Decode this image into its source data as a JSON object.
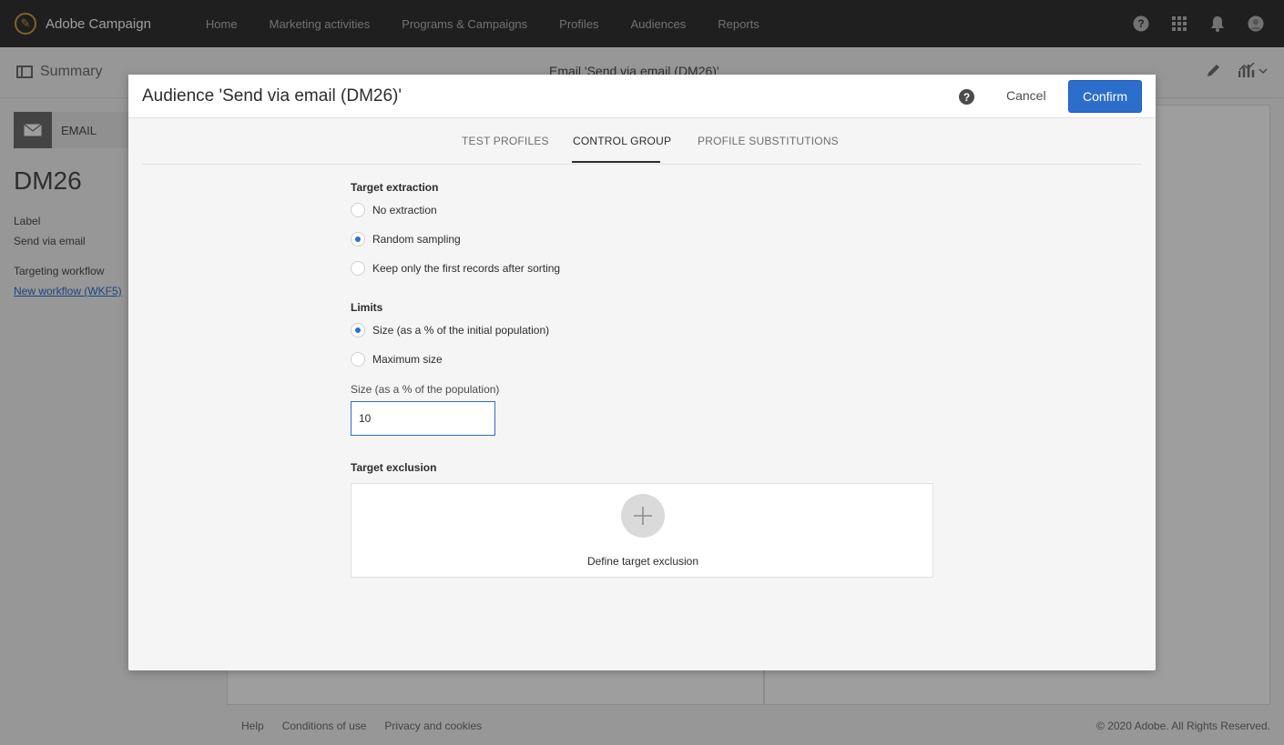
{
  "app": {
    "name": "Adobe Campaign"
  },
  "nav": [
    "Home",
    "Marketing activities",
    "Programs & Campaigns",
    "Profiles",
    "Audiences",
    "Reports"
  ],
  "top_icons": [
    "help-icon",
    "apps-grid-icon",
    "bell-icon",
    "avatar-icon"
  ],
  "subheader": {
    "summary": "Summary",
    "title": "Email 'Send via email (DM26)'"
  },
  "left": {
    "chip": "EMAIL",
    "code": "DM26",
    "label_caption": "Label",
    "label_value": "Send via email",
    "workflow_caption": "Targeting workflow",
    "workflow_link": "New workflow (WKF5)"
  },
  "footer": {
    "help": "Help",
    "terms": "Conditions of use",
    "privacy": "Privacy and cookies",
    "copyright": "© 2020 Adobe. All Rights Reserved."
  },
  "modal": {
    "title": "Audience 'Send via email (DM26)'",
    "cancel": "Cancel",
    "confirm": "Confirm",
    "tabs": [
      "TEST PROFILES",
      "CONTROL GROUP",
      "PROFILE SUBSTITUTIONS"
    ],
    "active_tab": "CONTROL GROUP",
    "target_extraction": {
      "label": "Target extraction",
      "options": [
        "No extraction",
        "Random sampling",
        "Keep only the first records after sorting"
      ],
      "selected": "Random sampling"
    },
    "limits": {
      "label": "Limits",
      "options": [
        "Size (as a % of the initial population)",
        "Maximum size"
      ],
      "selected": "Size (as a % of the initial population)"
    },
    "size_field": {
      "label": "Size (as a % of the population)",
      "value": "10"
    },
    "target_exclusion": {
      "label": "Target exclusion",
      "action": "Define target exclusion"
    }
  },
  "colors": {
    "accent": "#2c6ecb",
    "topbar": "#323232"
  }
}
